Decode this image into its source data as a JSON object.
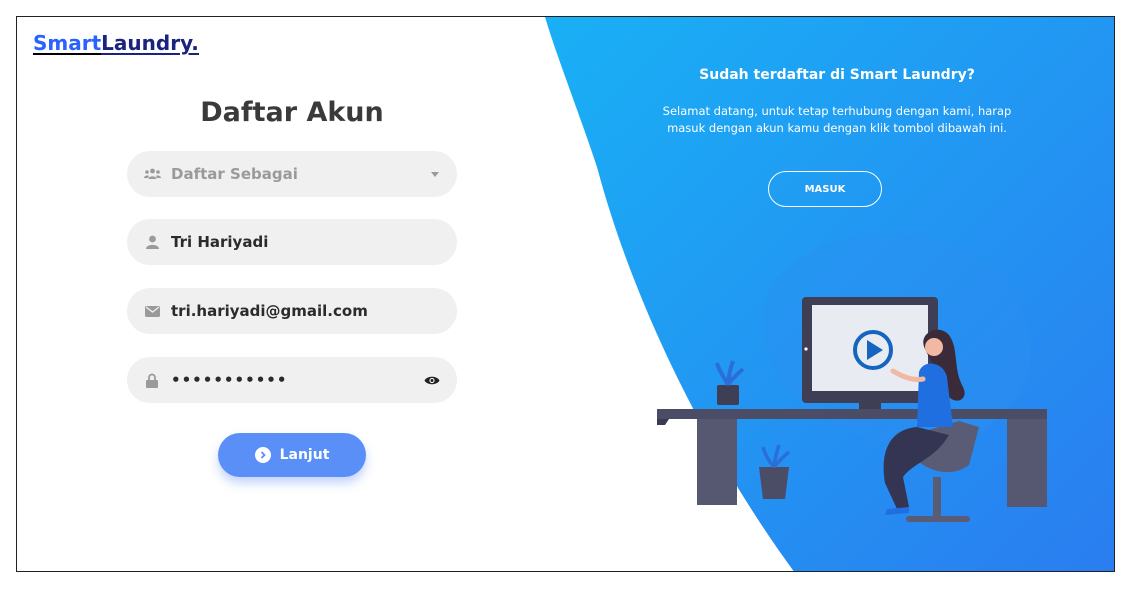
{
  "brand": {
    "part1": "Smart",
    "part2": "Laundry."
  },
  "form": {
    "title": "Daftar Akun",
    "role_select": {
      "placeholder": "Daftar Sebagai"
    },
    "name_field": {
      "value": "Tri Hariyadi"
    },
    "email_field": {
      "value": "tri.hariyadi@gmail.com"
    },
    "password_field": {
      "value": "•••••••••••"
    },
    "submit_label": "Lanjut"
  },
  "side_panel": {
    "title": "Sudah terdaftar di Smart Laundry?",
    "text": "Selamat datang, untuk tetap terhubung dengan kami, harap masuk dengan akun kamu dengan klik tombol dibawah ini.",
    "button_label": "MASUK"
  },
  "colors": {
    "accent": "#2196f3",
    "button_blue": "#5a8ff8",
    "field_bg": "#f0f0f0",
    "brand_dark": "#1a237e"
  },
  "icons": {
    "role": "users-icon",
    "name": "user-icon",
    "email": "envelope-icon",
    "password": "lock-icon",
    "reveal": "eye-icon",
    "submit": "arrow-circle-icon",
    "dropdown": "chevron-down-icon"
  }
}
